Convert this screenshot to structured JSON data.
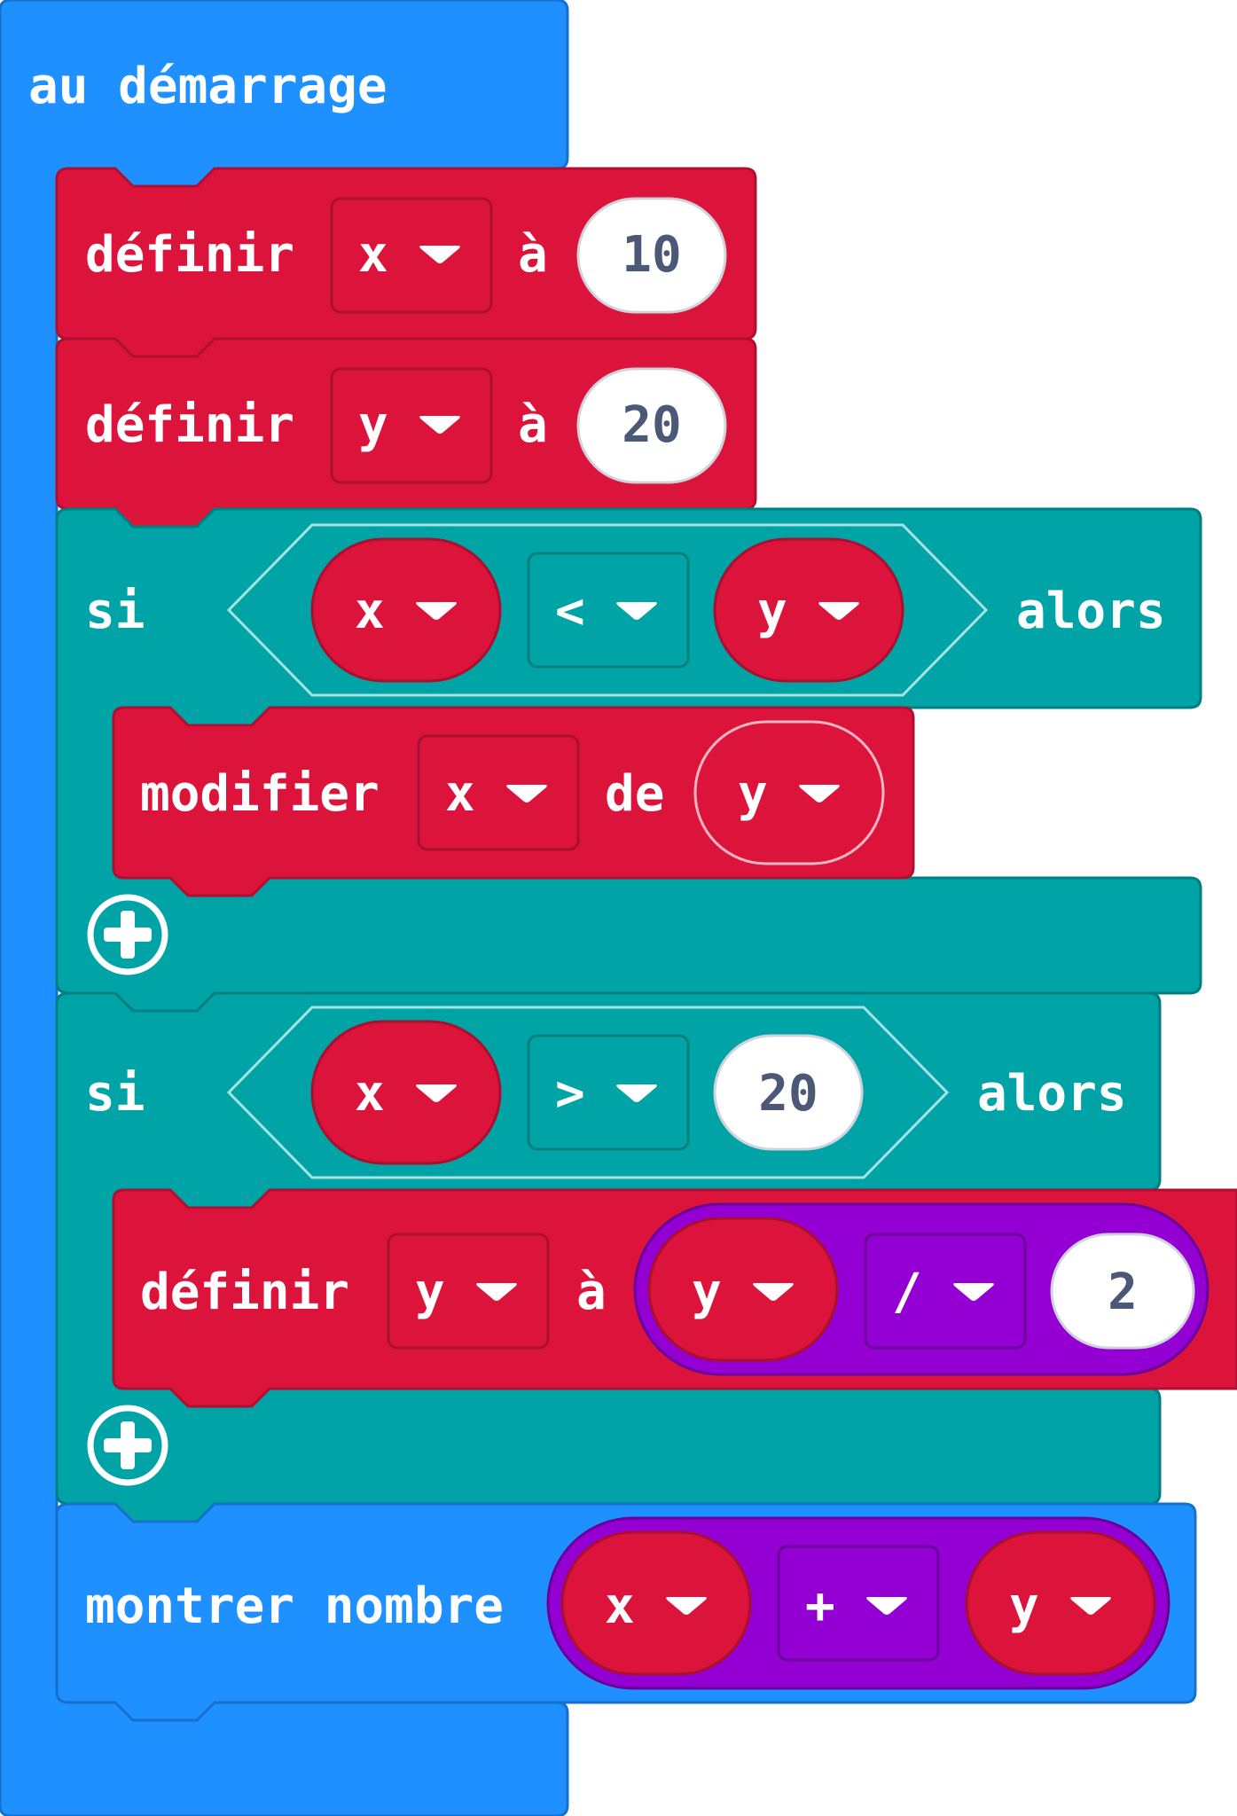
{
  "colors": {
    "basic": "#1E90FF",
    "variables": "#DC143C",
    "logic": "#00A4A6",
    "math": "#9400D3",
    "number_text": "#4b5876",
    "white": "#ffffff"
  },
  "on_start": {
    "label": "au démarrage"
  },
  "set_x": {
    "label": "définir",
    "variable": "x",
    "to_label": "à",
    "value": "10",
    "caret": "dropdown-caret-icon"
  },
  "set_y": {
    "label": "définir",
    "variable": "y",
    "to_label": "à",
    "value": "20"
  },
  "if1": {
    "label": "si",
    "left": "x",
    "operator": "<",
    "right": "y",
    "then_label": "alors",
    "change": {
      "label": "modifier",
      "variable": "x",
      "by_label": "de",
      "value": "y"
    },
    "add_icon": "plus-circle-icon"
  },
  "if2": {
    "label": "si",
    "left": "x",
    "operator": ">",
    "right": "20",
    "then_label": "alors",
    "set": {
      "label": "définir",
      "variable": "y",
      "to_label": "à",
      "left": "y",
      "operator": "/",
      "right": "2"
    },
    "add_icon": "plus-circle-icon"
  },
  "show_number": {
    "label": "montrer nombre",
    "left": "x",
    "operator": "+",
    "right": "y"
  }
}
